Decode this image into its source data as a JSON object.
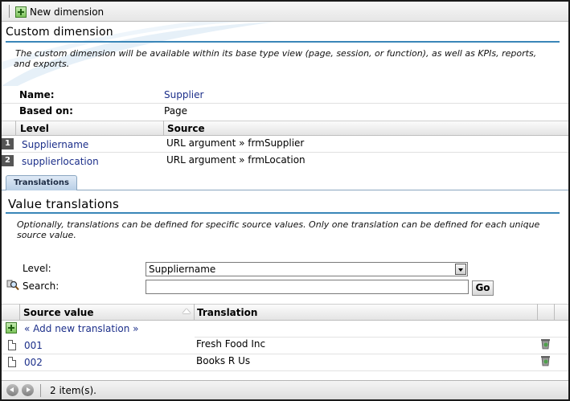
{
  "toolbar": {
    "new_dimension_label": "New dimension"
  },
  "custom_dimension": {
    "title": "Custom dimension",
    "description_line1": "The custom dimension will be available within its base type view (page, session, or function), as well as KPIs, reports,",
    "description_line2": "and exports.",
    "name_label": "Name:",
    "name_value": "Supplier",
    "based_on_label": "Based on:",
    "based_on_value": "Page"
  },
  "levels_table": {
    "columns": [
      "Level",
      "Source"
    ],
    "rows": [
      {
        "index": "1",
        "level": "Suppliername",
        "source": "URL argument » frmSupplier"
      },
      {
        "index": "2",
        "level": "supplierlocation",
        "source": "URL argument » frmLocation"
      }
    ]
  },
  "tabs": {
    "translations": "Translations"
  },
  "value_translations": {
    "title": "Value translations",
    "description_line1": "Optionally, translations can be defined for specific source values. Only one translation can be defined for each unique",
    "description_line2": "source value.",
    "level_label": "Level:",
    "level_selected": "Suppliername",
    "search_label": "Search:",
    "search_value": "",
    "go_label": "Go"
  },
  "translations_table": {
    "columns": [
      "Source value",
      "Translation"
    ],
    "add_link": "« Add new translation »",
    "rows": [
      {
        "source": "001",
        "translation": "Fresh Food Inc"
      },
      {
        "source": "002",
        "translation": "Books R Us"
      }
    ]
  },
  "footer": {
    "item_count": "2 item(s)."
  },
  "colors": {
    "accent_rule": "#3a86b8",
    "link": "#1c2f8a"
  }
}
